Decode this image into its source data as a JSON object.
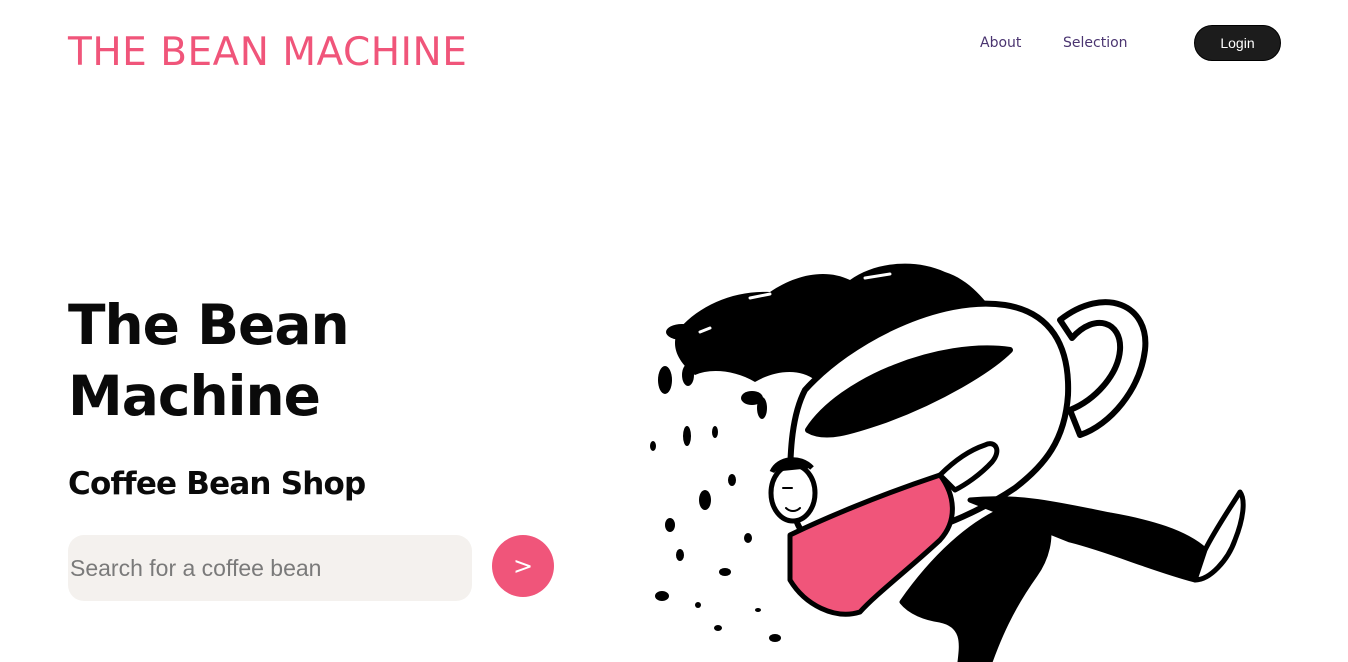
{
  "header": {
    "brand": "THE BEAN MACHINE",
    "nav": {
      "about": "About",
      "selection": "Selection"
    },
    "login_label": "Login"
  },
  "hero": {
    "title": "The Bean Machine",
    "subtitle": "Coffee Bean Shop",
    "search": {
      "placeholder": "Search for a coffee bean",
      "value": ""
    },
    "submit_label": ">",
    "illustration_icon": "person-hugging-coffee-cup-illustration"
  },
  "colors": {
    "accent": "#f0557a",
    "nav_text": "#4a3470",
    "login_bg": "#1c1c1c",
    "search_bg": "#f4f1ee",
    "text": "#0a0a0a"
  }
}
